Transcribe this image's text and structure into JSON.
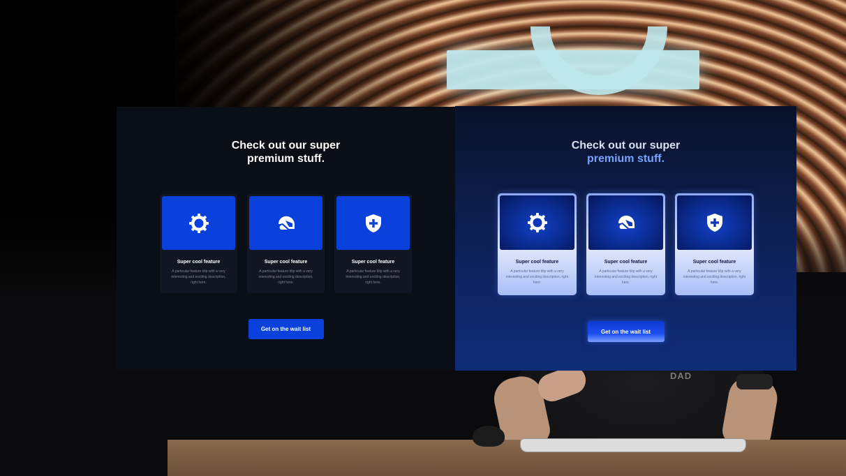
{
  "background": {
    "shirt_text": "DAD"
  },
  "panels": [
    {
      "variant": "before",
      "headline_line1": "Check out our super",
      "headline_line2": "premium stuff.",
      "cards": [
        {
          "icon": "gear-icon",
          "title": "Super cool feature",
          "description": "A particular feature blip with a very interesting and exciting description, right here."
        },
        {
          "icon": "helmet-icon",
          "title": "Super cool feature",
          "description": "A particular feature blip with a very interesting and exciting description, right here."
        },
        {
          "icon": "shield-plus-icon",
          "title": "Super cool feature",
          "description": "A particular feature blip with a very interesting and exciting description, right here."
        }
      ],
      "cta_label": "Get on the wait list",
      "colors": {
        "background": "#0a0e17",
        "accent": "#0a41dc"
      }
    },
    {
      "variant": "after",
      "headline_line1": "Check out our super",
      "headline_line2": "premium stuff.",
      "cards": [
        {
          "icon": "gear-icon",
          "title": "Super cool feature",
          "description": "A particular feature blip with a very interesting and exciting description, right here."
        },
        {
          "icon": "helmet-icon",
          "title": "Super cool feature",
          "description": "A particular feature blip with a very interesting and exciting description, right here."
        },
        {
          "icon": "shield-plus-icon",
          "title": "Super cool feature",
          "description": "A particular feature blip with a very interesting and exciting description, right here."
        }
      ],
      "cta_label": "Get on the wait list",
      "colors": {
        "background": "#0e2259",
        "accent": "#7aa2ff"
      }
    }
  ]
}
